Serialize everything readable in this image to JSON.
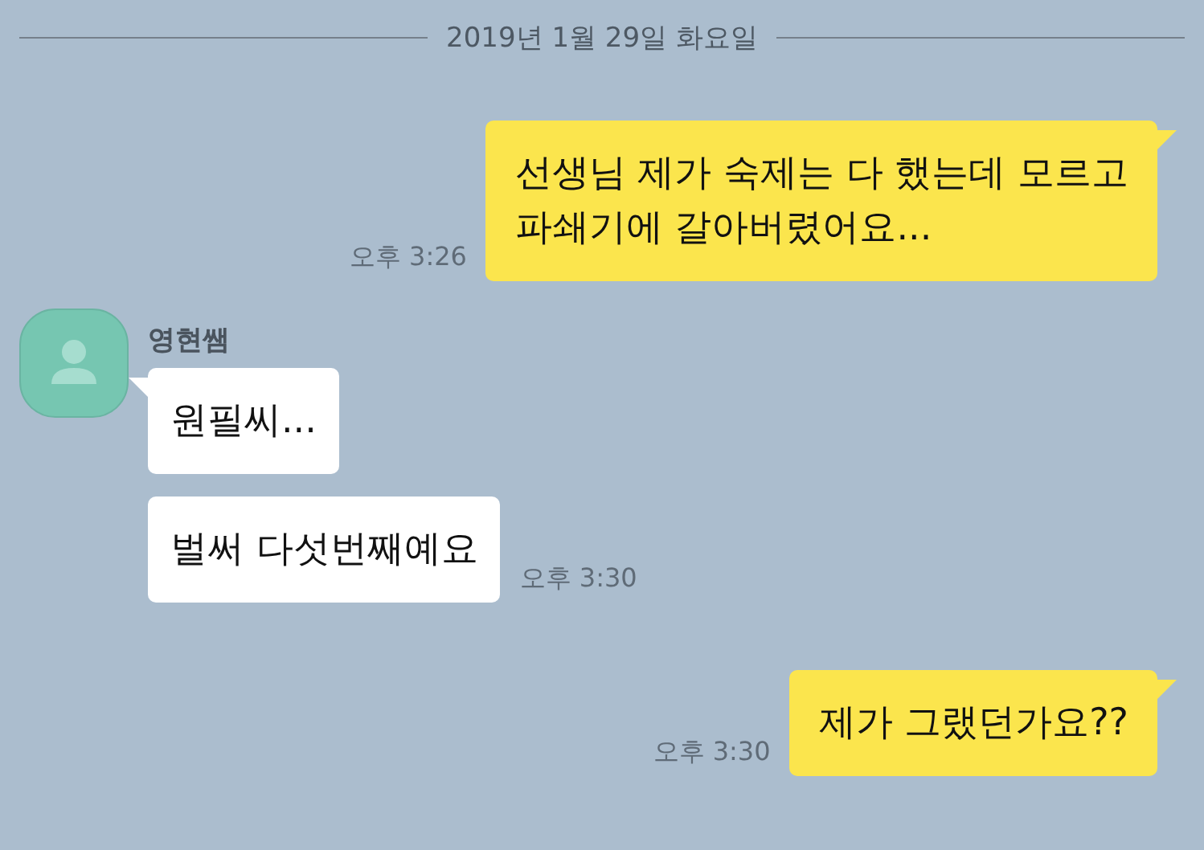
{
  "date_divider": "2019년 1월 29일 화요일",
  "messages": [
    {
      "kind": "sent",
      "text": "선생님 제가 숙제는 다 했는데 모르고\n파쇄기에 갈아버렸어요...",
      "time": "오후 3:26",
      "tail": true
    },
    {
      "kind": "received",
      "sender": "영현쌤",
      "text": "원필씨...",
      "tail": true
    },
    {
      "kind": "received",
      "text": "벌써 다섯번째예요",
      "time": "오후 3:30",
      "tail": false
    },
    {
      "kind": "sent",
      "text": "제가 그랬던가요??",
      "time": "오후 3:30",
      "tail": true
    }
  ]
}
